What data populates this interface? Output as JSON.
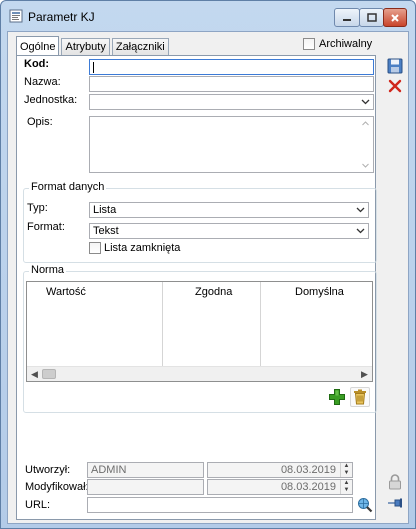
{
  "window": {
    "title": "Parametr KJ"
  },
  "tabs": [
    {
      "label": "Ogólne",
      "active": true
    },
    {
      "label": "Atrybuty",
      "active": false
    },
    {
      "label": "Załączniki",
      "active": false
    }
  ],
  "archiwalny": {
    "label": "Archiwalny",
    "checked": false
  },
  "fields": {
    "kod_label": "Kod:",
    "kod_value": "",
    "nazwa_label": "Nazwa:",
    "nazwa_value": "",
    "jednostka_label": "Jednostka:",
    "jednostka_value": "",
    "opis_label": "Opis:",
    "opis_value": ""
  },
  "format_danych": {
    "title": "Format danych",
    "typ_label": "Typ:",
    "typ_value": "Lista",
    "format_label": "Format:",
    "format_value": "Tekst",
    "lista_zamknieta_label": "Lista zamknięta",
    "lista_zamknieta_checked": false
  },
  "norma": {
    "title": "Norma",
    "columns": [
      "Wartość",
      "Zgodna",
      "Domyślna"
    ],
    "rows": []
  },
  "footer": {
    "utworzyl_label": "Utworzył:",
    "utworzyl_user": "ADMIN",
    "utworzyl_date": "08.03.2019",
    "modyfikowal_label": "Modyfikował:",
    "modyfikowal_user": "",
    "modyfikowal_date": "08.03.2019",
    "url_label": "URL:",
    "url_value": ""
  },
  "icons": {
    "save": "save-icon",
    "cancel": "close-icon",
    "add": "plus-icon",
    "delete": "trash-icon",
    "lock": "lock-icon",
    "pin": "pin-icon",
    "url_search": "globe-search-icon"
  },
  "colors": {
    "window_frame": "#b9cfea",
    "add_green": "#3a9d23",
    "cancel_red": "#d0261b",
    "focus_border": "#3d7bd6"
  }
}
